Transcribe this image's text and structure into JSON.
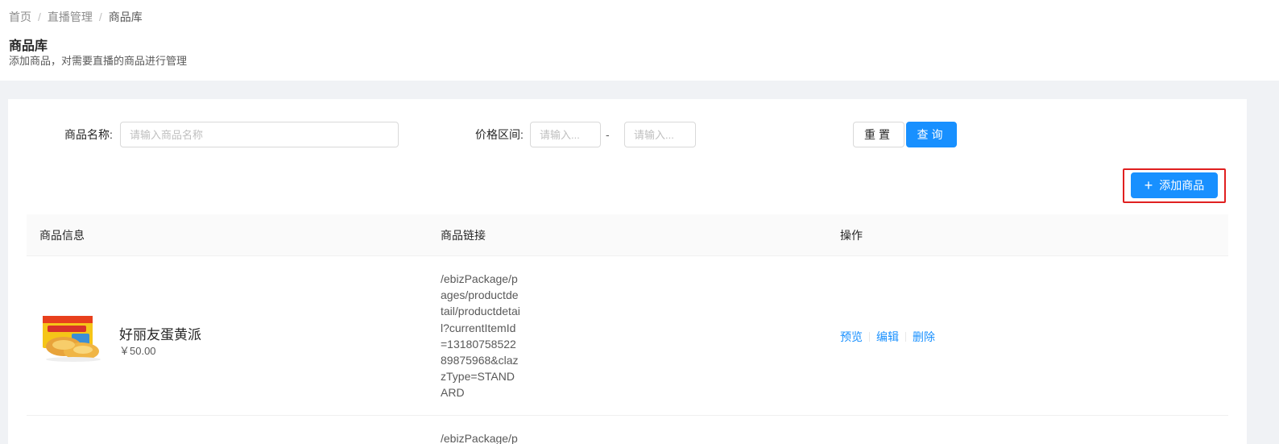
{
  "breadcrumb": {
    "home": "首页",
    "sep": "/",
    "live": "直播管理",
    "current": "商品库"
  },
  "header": {
    "title": "商品库",
    "description": "添加商品，对需要直播的商品进行管理"
  },
  "filters": {
    "name_label": "商品名称:",
    "name_placeholder": "请输入商品名称",
    "price_label": "价格区间:",
    "price_min_placeholder": "请输入...",
    "price_max_placeholder": "请输入...",
    "price_sep": "-",
    "reset_label": "重置",
    "query_label": "查询"
  },
  "add_button": {
    "icon": "plus-icon",
    "label": "添加商品"
  },
  "table": {
    "columns": [
      "商品信息",
      "商品链接",
      "操作"
    ],
    "rows": [
      {
        "name": "好丽友蛋黄派",
        "price": "￥50.00",
        "link": "/ebizPackage/pages/productdetail/productdetail?currentItemId=1318075852289875968&clazzType=STANDARD",
        "actions": [
          "预览",
          "编辑",
          "删除"
        ]
      },
      {
        "link_partial": "/ebizPackage/p"
      }
    ]
  },
  "colors": {
    "primary": "#1890ff",
    "highlight": "#e02020"
  }
}
